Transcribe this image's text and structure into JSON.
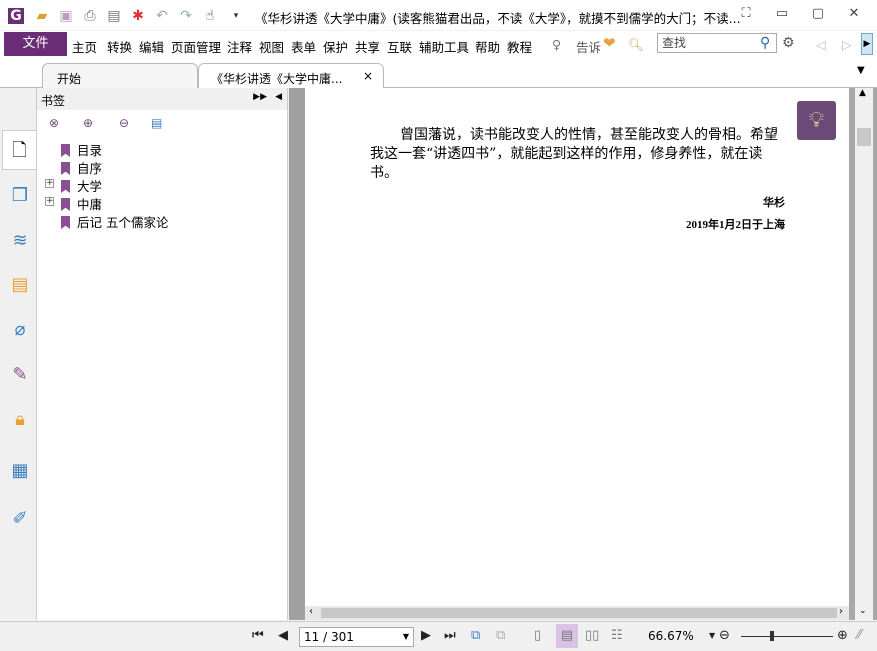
{
  "window": {
    "title": "《华杉讲透《大学中庸》(读客熊猫君出品，不读《大学》，就摸不到儒学的大门；不读..."
  },
  "menu": {
    "file": "文件",
    "items": [
      "主页",
      "转换",
      "编辑",
      "页面管理",
      "注释",
      "视图",
      "表单",
      "保护",
      "共享",
      "互联",
      "辅助工具",
      "帮助",
      "教程"
    ],
    "tell": "告诉",
    "search_placeholder": "查找"
  },
  "tabs": [
    {
      "label": "开始"
    },
    {
      "label": "《华杉讲透《大学中庸...",
      "close": "×"
    }
  ],
  "bookmarks": {
    "title": "书签",
    "items": [
      {
        "label": "目录",
        "expandable": false
      },
      {
        "label": "自序",
        "expandable": false
      },
      {
        "label": "大学",
        "expandable": true
      },
      {
        "label": "中庸",
        "expandable": true
      },
      {
        "label": "后记 五个儒家论",
        "expandable": false
      }
    ]
  },
  "page": {
    "paragraph": "曾国藩说，读书能改变人的性情，甚至能改变人的骨相。希望我这一套“讲透四书”，就能起到这样的作用，修身养性，就在读书。",
    "author": "华杉",
    "date": "2019年1月2日于上海"
  },
  "status": {
    "page": "11 / 301",
    "zoom": "66.67%",
    "zoom_slider": 0.35
  },
  "colors": {
    "accent": "#6b2d77",
    "bookmark": "#8a4f92"
  }
}
